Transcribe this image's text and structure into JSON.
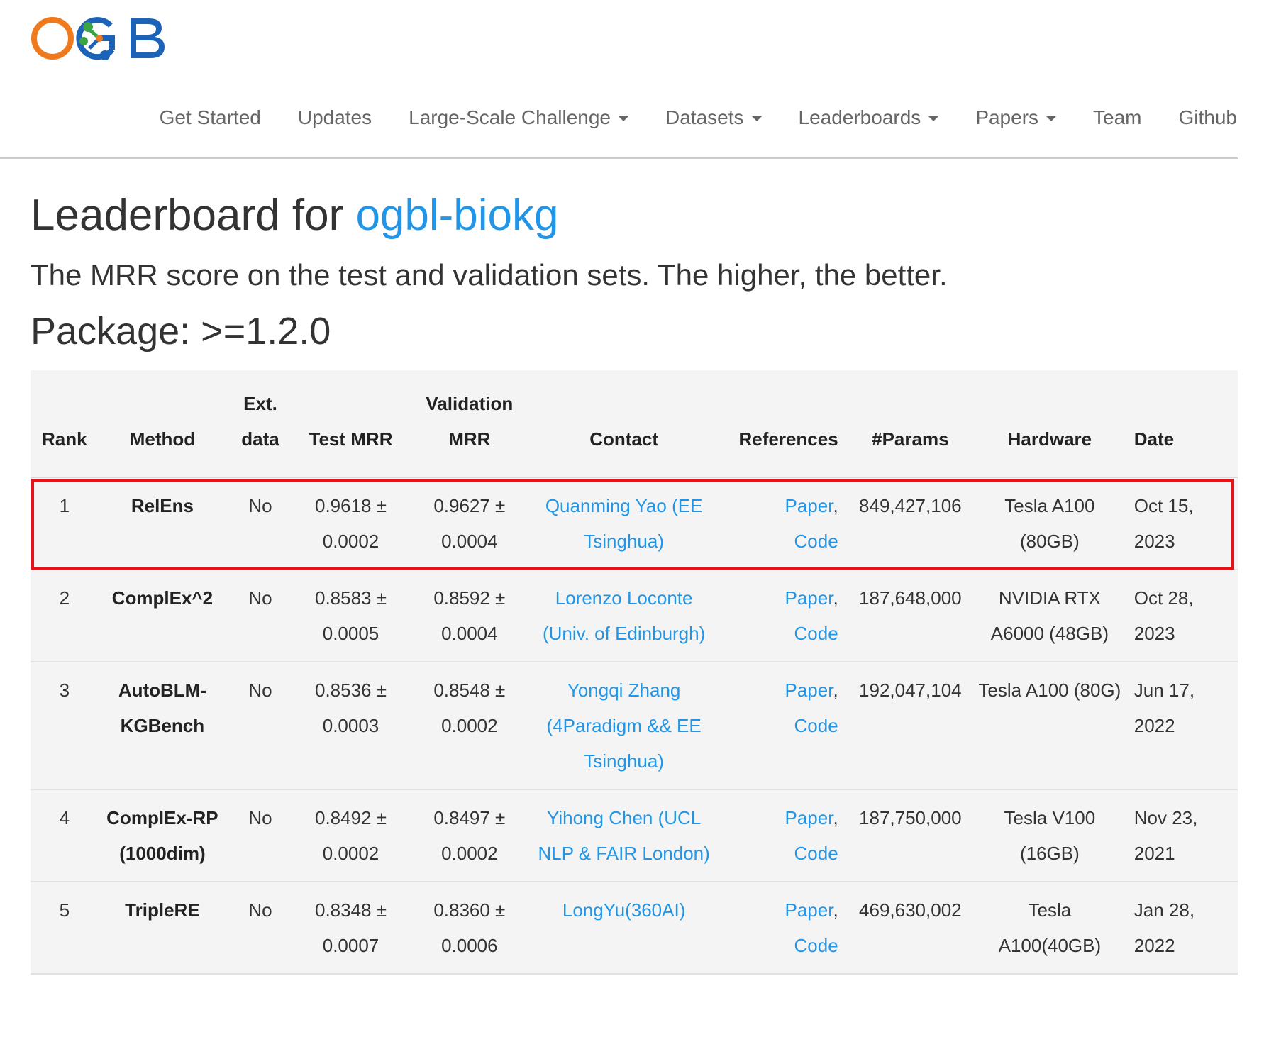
{
  "logo": {
    "alt": "OGB"
  },
  "nav": {
    "items": [
      {
        "label": "Get Started",
        "dropdown": false
      },
      {
        "label": "Updates",
        "dropdown": false
      },
      {
        "label": "Large-Scale Challenge",
        "dropdown": true
      },
      {
        "label": "Datasets",
        "dropdown": true
      },
      {
        "label": "Leaderboards",
        "dropdown": true
      },
      {
        "label": "Papers",
        "dropdown": true
      },
      {
        "label": "Team",
        "dropdown": false
      },
      {
        "label": "Github",
        "dropdown": false
      }
    ]
  },
  "header": {
    "title_prefix": "Leaderboard for ",
    "dataset_link": "ogbl-biokg",
    "subtitle": "The MRR score on the test and validation sets. The higher, the better.",
    "package": "Package: >=1.2.0"
  },
  "table": {
    "columns": [
      "Rank",
      "Method",
      "Ext. data",
      "Test MRR",
      "Validation MRR",
      "Contact",
      "References",
      "#Params",
      "Hardware",
      "Date"
    ],
    "rows": [
      {
        "rank": "1",
        "method": "RelEns",
        "ext": "No",
        "test": "0.9618 ± 0.0002",
        "valid": "0.9627 ± 0.0004",
        "contact": "Quanming Yao (EE Tsinghua)",
        "paper": "Paper",
        "code": "Code",
        "params": "849,427,106",
        "hardware": "Tesla A100 (80GB)",
        "date": "Oct 15, 2023"
      },
      {
        "rank": "2",
        "method": "ComplEx^2",
        "ext": "No",
        "test": "0.8583 ± 0.0005",
        "valid": "0.8592 ± 0.0004",
        "contact": "Lorenzo Loconte (Univ. of Edinburgh)",
        "paper": "Paper",
        "code": "Code",
        "params": "187,648,000",
        "hardware": "NVIDIA RTX A6000 (48GB)",
        "date": "Oct 28, 2023"
      },
      {
        "rank": "3",
        "method": "AutoBLM-KGBench",
        "ext": "No",
        "test": "0.8536 ± 0.0003",
        "valid": "0.8548 ± 0.0002",
        "contact": "Yongqi Zhang (4Paradigm && EE Tsinghua)",
        "paper": "Paper",
        "code": "Code",
        "params": "192,047,104",
        "hardware": "Tesla A100 (80G)",
        "date": "Jun 17, 2022"
      },
      {
        "rank": "4",
        "method": "ComplEx-RP (1000dim)",
        "ext": "No",
        "test": "0.8492 ± 0.0002",
        "valid": "0.8497 ± 0.0002",
        "contact": "Yihong Chen (UCL NLP & FAIR London)",
        "paper": "Paper",
        "code": "Code",
        "params": "187,750,000",
        "hardware": "Tesla V100 (16GB)",
        "date": "Nov 23, 2021"
      },
      {
        "rank": "5",
        "method": "TripleRE",
        "ext": "No",
        "test": "0.8348 ± 0.0007",
        "valid": "0.8360 ± 0.0006",
        "contact": "LongYu(360AI)",
        "paper": "Paper",
        "code": "Code",
        "params": "469,630,002",
        "hardware": "Tesla A100(40GB)",
        "date": "Jan 28, 2022"
      }
    ]
  },
  "colors": {
    "accent": "#2196e8",
    "highlight": "#e8131a",
    "logo_orange": "#ee7a1d",
    "logo_green": "#3aa542",
    "logo_blue": "#1c63b7"
  }
}
